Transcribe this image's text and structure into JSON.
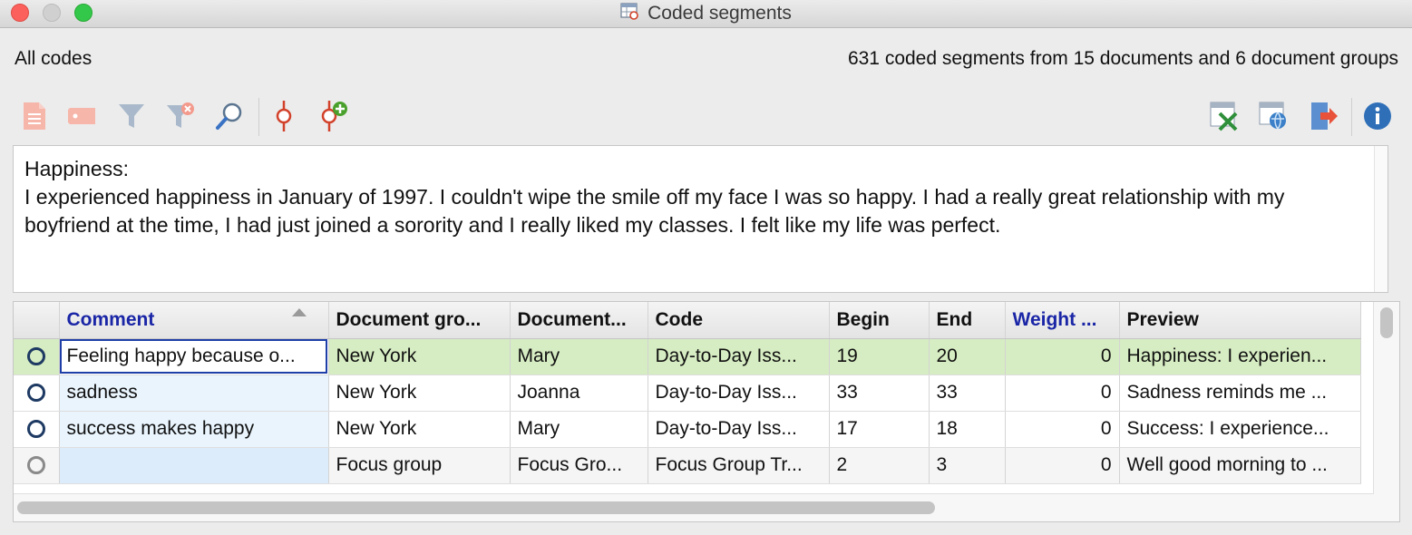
{
  "window": {
    "title": "Coded segments"
  },
  "info": {
    "left": "All codes",
    "right": "631 coded segments from 15 documents and 6 document groups"
  },
  "toolbar": {
    "left_icons": [
      "document-icon",
      "tag-icon",
      "filter-icon",
      "clear-filter-icon",
      "search-icon",
      "code-pin-icon",
      "add-code-pin-icon"
    ],
    "right_icons": [
      "excel-export-icon",
      "web-export-icon",
      "export-icon",
      "info-icon"
    ]
  },
  "preview": {
    "heading": "Happiness:",
    "body": "I experienced happiness in January of 1997. I couldn't wipe the smile off my face I was so happy. I had a really great relationship with my boyfriend at the time, I had just joined a sorority and I really liked my classes. I felt like my life was perfect."
  },
  "table": {
    "columns": [
      "Comment",
      "Document gro...",
      "Document...",
      "Code",
      "Begin",
      "End",
      "Weight ...",
      "Preview"
    ],
    "rows": [
      {
        "comment": "Feeling happy because o...",
        "group": "New York",
        "document": "Mary",
        "code": "Day-to-Day Iss...",
        "begin": "19",
        "end": "20",
        "weight": "0",
        "preview": "Happiness: I experien..."
      },
      {
        "comment": "sadness",
        "group": "New York",
        "document": "Joanna",
        "code": "Day-to-Day Iss...",
        "begin": "33",
        "end": "33",
        "weight": "0",
        "preview": "Sadness reminds me ..."
      },
      {
        "comment": "success makes happy",
        "group": "New York",
        "document": "Mary",
        "code": "Day-to-Day Iss...",
        "begin": "17",
        "end": "18",
        "weight": "0",
        "preview": "Success: I experience..."
      },
      {
        "comment": "",
        "group": "Focus group",
        "document": "Focus Gro...",
        "code": "Focus Group Tr...",
        "begin": "2",
        "end": "3",
        "weight": "0",
        "preview": "Well good morning to ..."
      }
    ]
  },
  "colors": {
    "header_blue": "#1a26a6",
    "selected_row": "#d6ecc2",
    "comment_column": "#e3f1fd"
  }
}
